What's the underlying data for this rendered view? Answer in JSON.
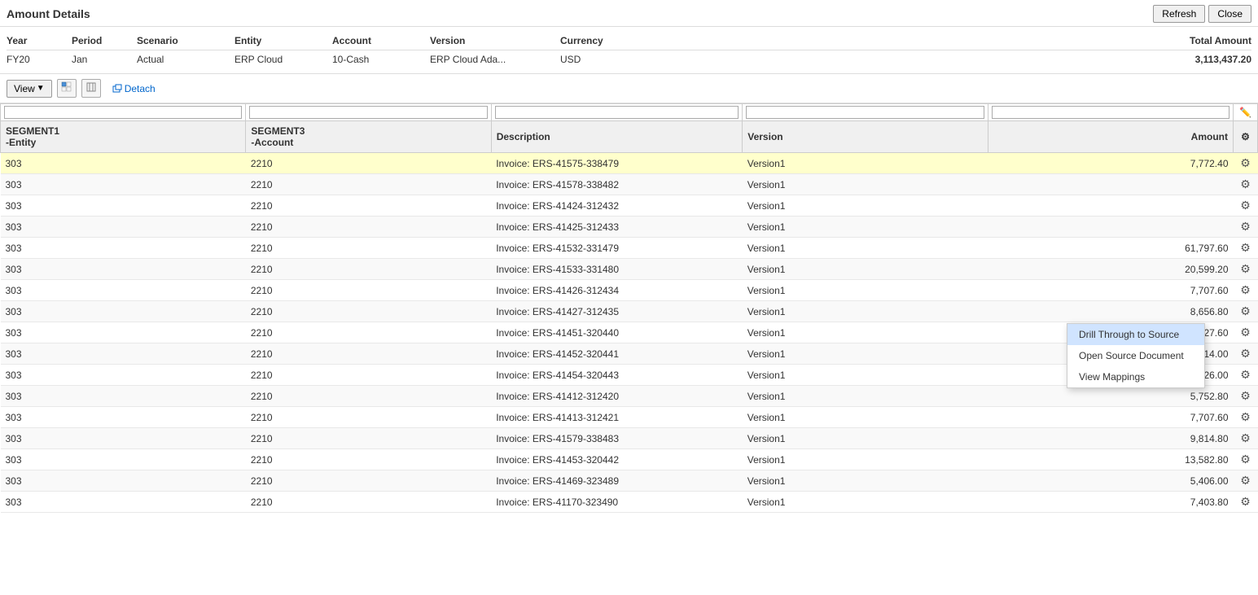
{
  "page": {
    "title": "Amount Details",
    "refresh_label": "Refresh",
    "close_label": "Close"
  },
  "summary": {
    "headers": {
      "year": "Year",
      "period": "Period",
      "scenario": "Scenario",
      "entity": "Entity",
      "account": "Account",
      "version": "Version",
      "currency": "Currency",
      "total_amount": "Total Amount"
    },
    "row": {
      "year": "FY20",
      "period": "Jan",
      "scenario": "Actual",
      "entity": "ERP Cloud",
      "account": "10-Cash",
      "version": "ERP Cloud Ada...",
      "currency": "USD",
      "total_amount": "3,113,437.20"
    }
  },
  "toolbar": {
    "view_label": "View",
    "detach_label": "Detach"
  },
  "table": {
    "columns": {
      "segment1": "SEGMENT1\n-Entity",
      "segment3": "SEGMENT3\n-Account",
      "description": "Description",
      "version": "Version",
      "amount": "Amount"
    },
    "rows": [
      {
        "segment1": "303",
        "segment3": "2210",
        "description": "Invoice: ERS-41575-338479",
        "version": "Version1",
        "amount": "7,772.40",
        "highlighted": true
      },
      {
        "segment1": "303",
        "segment3": "2210",
        "description": "Invoice: ERS-41578-338482",
        "version": "Version1",
        "amount": "",
        "highlighted": false
      },
      {
        "segment1": "303",
        "segment3": "2210",
        "description": "Invoice: ERS-41424-312432",
        "version": "Version1",
        "amount": "",
        "highlighted": false
      },
      {
        "segment1": "303",
        "segment3": "2210",
        "description": "Invoice: ERS-41425-312433",
        "version": "Version1",
        "amount": "",
        "highlighted": false
      },
      {
        "segment1": "303",
        "segment3": "2210",
        "description": "Invoice: ERS-41532-331479",
        "version": "Version1",
        "amount": "61,797.60",
        "highlighted": false
      },
      {
        "segment1": "303",
        "segment3": "2210",
        "description": "Invoice: ERS-41533-331480",
        "version": "Version1",
        "amount": "20,599.20",
        "highlighted": false
      },
      {
        "segment1": "303",
        "segment3": "2210",
        "description": "Invoice: ERS-41426-312434",
        "version": "Version1",
        "amount": "7,707.60",
        "highlighted": false
      },
      {
        "segment1": "303",
        "segment3": "2210",
        "description": "Invoice: ERS-41427-312435",
        "version": "Version1",
        "amount": "8,656.80",
        "highlighted": false
      },
      {
        "segment1": "303",
        "segment3": "2210",
        "description": "Invoice: ERS-41451-320440",
        "version": "Version1",
        "amount": "7,227.60",
        "highlighted": false
      },
      {
        "segment1": "303",
        "segment3": "2210",
        "description": "Invoice: ERS-41452-320441",
        "version": "Version1",
        "amount": "12,714.00",
        "highlighted": false
      },
      {
        "segment1": "303",
        "segment3": "2210",
        "description": "Invoice: ERS-41454-320443",
        "version": "Version1",
        "amount": "17,226.00",
        "highlighted": false
      },
      {
        "segment1": "303",
        "segment3": "2210",
        "description": "Invoice: ERS-41412-312420",
        "version": "Version1",
        "amount": "5,752.80",
        "highlighted": false
      },
      {
        "segment1": "303",
        "segment3": "2210",
        "description": "Invoice: ERS-41413-312421",
        "version": "Version1",
        "amount": "7,707.60",
        "highlighted": false
      },
      {
        "segment1": "303",
        "segment3": "2210",
        "description": "Invoice: ERS-41579-338483",
        "version": "Version1",
        "amount": "9,814.80",
        "highlighted": false
      },
      {
        "segment1": "303",
        "segment3": "2210",
        "description": "Invoice: ERS-41453-320442",
        "version": "Version1",
        "amount": "13,582.80",
        "highlighted": false
      },
      {
        "segment1": "303",
        "segment3": "2210",
        "description": "Invoice: ERS-41469-323489",
        "version": "Version1",
        "amount": "5,406.00",
        "highlighted": false
      },
      {
        "segment1": "303",
        "segment3": "2210",
        "description": "Invoice: ERS-41170-323490",
        "version": "Version1",
        "amount": "7,403.80",
        "highlighted": false
      }
    ]
  },
  "context_menu": {
    "items": [
      {
        "id": "drill-through",
        "label": "Drill Through to Source",
        "active": true
      },
      {
        "id": "open-source",
        "label": "Open Source Document",
        "active": false
      },
      {
        "id": "view-mappings",
        "label": "View Mappings",
        "active": false
      }
    ]
  }
}
